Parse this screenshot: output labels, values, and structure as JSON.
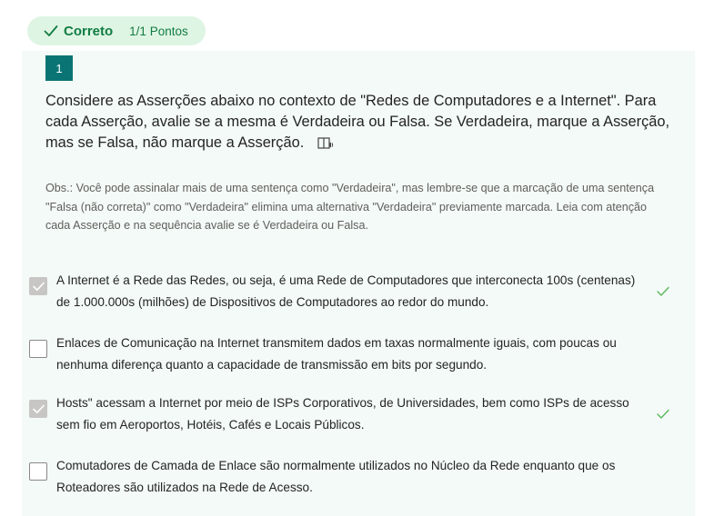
{
  "status": {
    "label": "Correto",
    "points": "1/1 Pontos"
  },
  "question": {
    "number": "1",
    "text": "Considere as Asserções abaixo no contexto de \"Redes de Computadores e a Internet\". Para cada Asserção, avalie se a mesma é Verdadeira ou Falsa. Se Verdadeira, marque a Asserção, mas se Falsa, não marque a Asserção.",
    "note": "Obs.: Você pode assinalar mais de uma sentença como \"Verdadeira\", mas lembre-se que a marcação de uma sentença \"Falsa (não correta)\" como \"Verdadeira\" elimina uma alternativa \"Verdadeira\" previamente marcada. Leia com atenção cada Asserção e na sequência avalie se é Verdadeira ou Falsa."
  },
  "options": [
    {
      "text": "A Internet é a Rede das Redes, ou seja, é uma Rede de Computadores que interconecta 100s (centenas) de 1.000.000s (milhões) de Dispositivos de Computadores ao redor do mundo.",
      "checked": true,
      "correct": true
    },
    {
      "text": "Enlaces de Comunicação na Internet transmitem dados em taxas normalmente iguais, com poucas ou nenhuma diferença quanto a capacidade de transmissão em bits por segundo.",
      "checked": false,
      "correct": false
    },
    {
      "text": "Hosts\" acessam a Internet por meio de ISPs Corporativos, de Universidades, bem como ISPs de acesso sem fio em Aeroportos, Hotéis, Cafés e Locais Públicos.",
      "checked": true,
      "correct": true
    },
    {
      "text": "Comutadores de Camada de Enlace são normalmente utilizados no Núcleo da Rede enquanto que os Roteadores são utilizados na Rede de Acesso.",
      "checked": false,
      "correct": false
    }
  ],
  "icons": {
    "status_check": "checkmark-icon",
    "immersive_reader": "immersive-reader-icon",
    "checkbox_check": "checkmark-icon",
    "correct_mark": "correct-checkmark-icon"
  },
  "colors": {
    "status_green": "#107c41",
    "status_bg": "#dff5e4",
    "question_number_bg": "#0a7474",
    "panel_bg": "#f3faf7",
    "correct_check": "#5cb85c"
  }
}
